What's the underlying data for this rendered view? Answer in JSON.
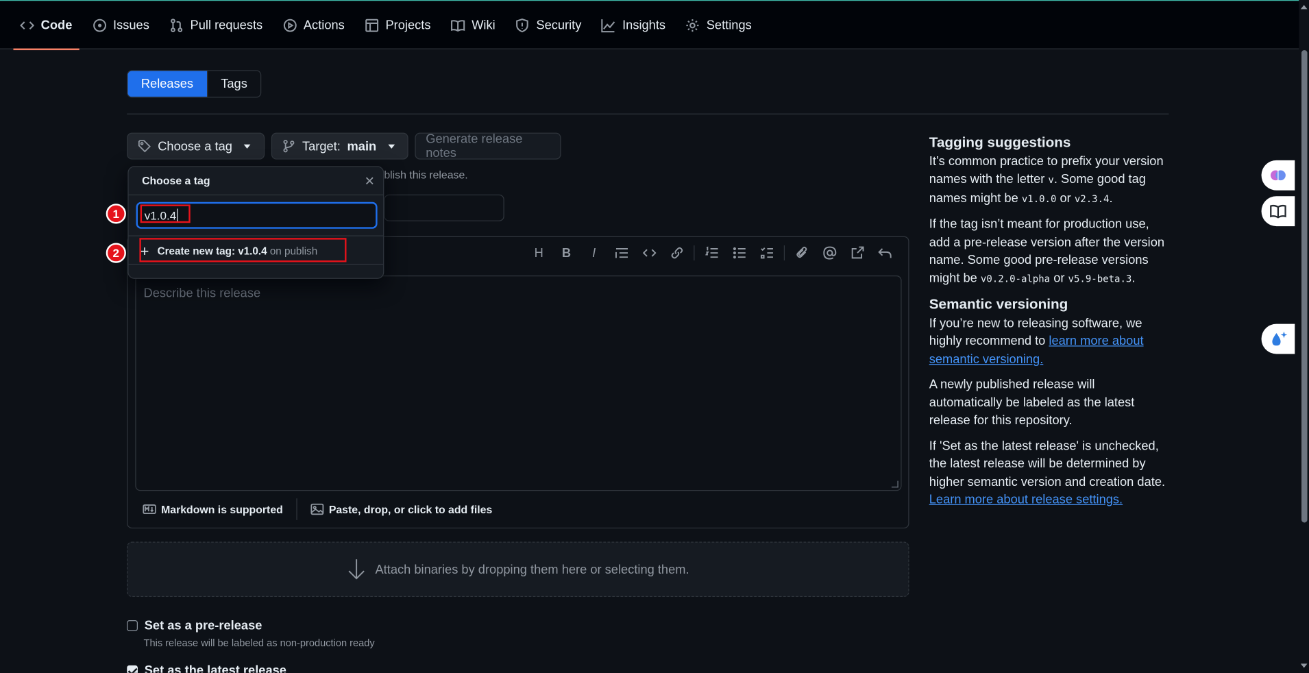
{
  "nav": {
    "items": [
      {
        "label": "Code",
        "icon": "code-icon"
      },
      {
        "label": "Issues",
        "icon": "issue-icon"
      },
      {
        "label": "Pull requests",
        "icon": "pull-request-icon"
      },
      {
        "label": "Actions",
        "icon": "play-icon"
      },
      {
        "label": "Projects",
        "icon": "table-icon"
      },
      {
        "label": "Wiki",
        "icon": "book-icon"
      },
      {
        "label": "Security",
        "icon": "shield-icon"
      },
      {
        "label": "Insights",
        "icon": "graph-icon"
      },
      {
        "label": "Settings",
        "icon": "gear-icon"
      }
    ]
  },
  "tabs": {
    "releases": "Releases",
    "tags": "Tags"
  },
  "release_form": {
    "choose_tag": "Choose a tag",
    "target_label": "Target:",
    "target_value": "main",
    "generate_notes": "Generate release notes",
    "hint_partial": "blish this release.",
    "describe_placeholder": "Describe this release",
    "markdown_supported": "Markdown is supported",
    "add_files": "Paste, drop, or click to add files",
    "attach": "Attach binaries by dropping them here or selecting them.",
    "prerelease_label": "Set as a pre-release",
    "prerelease_sub": "This release will be labeled as non-production ready",
    "latest_label": "Set as the latest release"
  },
  "dropdown": {
    "title": "Choose a tag",
    "input_value": "v1.0.4",
    "create_prefix": "Create new tag: v1.0.4",
    "create_suffix": "on publish"
  },
  "markers": {
    "one": "1",
    "two": "2"
  },
  "sidebar": {
    "tagging_title": "Tagging suggestions",
    "tagging_p1_a": "It’s common practice to prefix your version names with the letter ",
    "tagging_p1_v": "v",
    "tagging_p1_b": ". Some good tag names might be ",
    "tagging_p1_code1": "v1.0.0",
    "tagging_p1_or": " or ",
    "tagging_p1_code2": "v2.3.4",
    "tagging_p1_end": ".",
    "tagging_p2_a": "If the tag isn’t meant for production use, add a pre-release version after the version name. Some good pre-release versions might be ",
    "tagging_p2_code1": "v0.2.0-alpha",
    "tagging_p2_or": " or ",
    "tagging_p2_code2": "v5.9-beta.3",
    "tagging_p2_end": ".",
    "semver_title": "Semantic versioning",
    "semver_p1_a": "If you’re new to releasing software, we highly recommend to ",
    "semver_p1_link": "learn more about semantic versioning.",
    "semver_p2": "A newly published release will automatically be labeled as the latest release for this repository.",
    "semver_p3_a": "If 'Set as the latest release' is unchecked, the latest release will be determined by higher semantic version and creation date. ",
    "semver_p3_link": "Learn more about release settings."
  },
  "colors": {
    "accent": "#1f6feb",
    "annotation": "#e5131b",
    "link": "#4493f8",
    "background": "#0d1117"
  }
}
